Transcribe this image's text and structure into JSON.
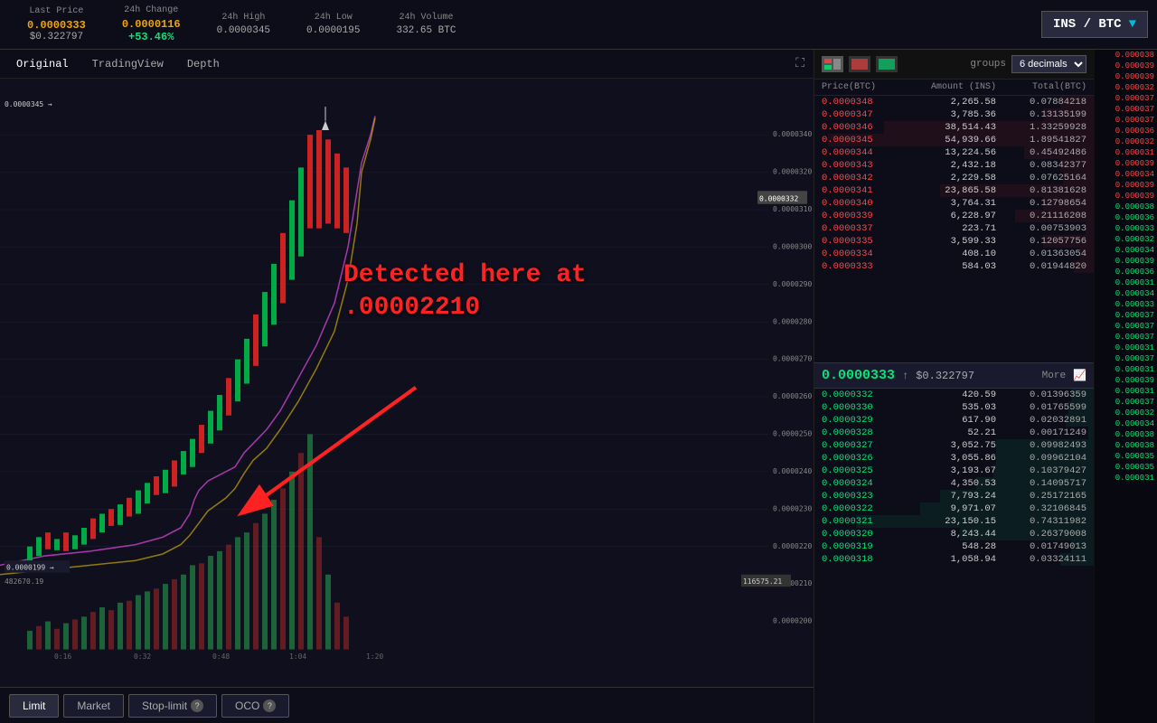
{
  "header": {
    "last_price_label": "Last Price",
    "last_price_btc": "0.0000333",
    "last_price_usd": "$0.322797",
    "change_label": "24h Change",
    "change_btc": "0.0000116",
    "change_pct": "+53.46%",
    "high_label": "24h High",
    "high_val": "0.0000345",
    "low_label": "24h Low",
    "low_val": "0.0000195",
    "volume_label": "24h Volume",
    "volume_val": "332.65 BTC",
    "pair": "INS / BTC"
  },
  "chart_tabs": {
    "original": "Original",
    "tradingview": "TradingView",
    "depth": "Depth",
    "active": "Original"
  },
  "price_labels": {
    "high_arrow": "0.0000345 →",
    "current_price": "0.0000332",
    "low_left": "0.0000199 →",
    "y_labels": [
      "0.0000340",
      "0.0000320",
      "0.0000310",
      "0.0000300",
      "0.0000290",
      "0.0000280",
      "0.0000270",
      "0.0000260",
      "0.0000250",
      "0.0000240",
      "0.0000230",
      "0.0000220",
      "0.0000210",
      "0.0000200"
    ],
    "vol_label": "482670.19",
    "vol_label2": "116575.21"
  },
  "x_labels": [
    "0:16",
    "0:32",
    "0:48",
    "1:04",
    "1:20"
  ],
  "annotation": {
    "line1": "Detected here at",
    "line2": ".00002210"
  },
  "order_book": {
    "groups_label": "groups",
    "decimals": "6 decimals",
    "col_price": "Price(BTC)",
    "col_amount": "Amount (INS)",
    "col_total": "Total(BTC)",
    "sell_orders": [
      {
        "price": "0.0000348",
        "amount": "2,265.58",
        "total": "0.07884218",
        "bar_pct": 12
      },
      {
        "price": "0.0000347",
        "amount": "3,785.36",
        "total": "0.13135199",
        "bar_pct": 18
      },
      {
        "price": "0.0000346",
        "amount": "38,514.43",
        "total": "1.33259928",
        "bar_pct": 75
      },
      {
        "price": "0.0000345",
        "amount": "54,939.66",
        "total": "1.89541827",
        "bar_pct": 95
      },
      {
        "price": "0.0000344",
        "amount": "13,224.56",
        "total": "0.45492486",
        "bar_pct": 25
      },
      {
        "price": "0.0000343",
        "amount": "2,432.18",
        "total": "0.08342377",
        "bar_pct": 12
      },
      {
        "price": "0.0000342",
        "amount": "2,229.58",
        "total": "0.07625164",
        "bar_pct": 11
      },
      {
        "price": "0.0000341",
        "amount": "23,865.58",
        "total": "0.81381628",
        "bar_pct": 55
      },
      {
        "price": "0.0000340",
        "amount": "3,764.31",
        "total": "0.12798654",
        "bar_pct": 18
      },
      {
        "price": "0.0000339",
        "amount": "6,228.97",
        "total": "0.21116208",
        "bar_pct": 28
      },
      {
        "price": "0.0000337",
        "amount": "223.71",
        "total": "0.00753903",
        "bar_pct": 3
      },
      {
        "price": "0.0000335",
        "amount": "3,599.33",
        "total": "0.12057756",
        "bar_pct": 18
      },
      {
        "price": "0.0000334",
        "amount": "408.10",
        "total": "0.01363054",
        "bar_pct": 5
      },
      {
        "price": "0.0000333",
        "amount": "584.03",
        "total": "0.01944820",
        "bar_pct": 7
      }
    ],
    "current_price": "0.0000333",
    "current_arrow": "↑",
    "current_usd": "$0.322797",
    "more_label": "More",
    "buy_orders": [
      {
        "price": "0.0000332",
        "amount": "420.59",
        "total": "0.01396359",
        "bar_pct": 8
      },
      {
        "price": "0.0000330",
        "amount": "535.03",
        "total": "0.01765599",
        "bar_pct": 9
      },
      {
        "price": "0.0000329",
        "amount": "617.90",
        "total": "0.02032891",
        "bar_pct": 10
      },
      {
        "price": "0.0000328",
        "amount": "52.21",
        "total": "0.00171249",
        "bar_pct": 2
      },
      {
        "price": "0.0000327",
        "amount": "3,052.75",
        "total": "0.09982493",
        "bar_pct": 35
      },
      {
        "price": "0.0000326",
        "amount": "3,055.86",
        "total": "0.09962104",
        "bar_pct": 35
      },
      {
        "price": "0.0000325",
        "amount": "3,193.67",
        "total": "0.10379427",
        "bar_pct": 36
      },
      {
        "price": "0.0000324",
        "amount": "4,350.53",
        "total": "0.14095717",
        "bar_pct": 42
      },
      {
        "price": "0.0000323",
        "amount": "7,793.24",
        "total": "0.25172165",
        "bar_pct": 55
      },
      {
        "price": "0.0000322",
        "amount": "9,971.07",
        "total": "0.32106845",
        "bar_pct": 62
      },
      {
        "price": "0.0000321",
        "amount": "23,150.15",
        "total": "0.74311982",
        "bar_pct": 85
      },
      {
        "price": "0.0000320",
        "amount": "8,243.44",
        "total": "0.26379008",
        "bar_pct": 48
      },
      {
        "price": "0.0000319",
        "amount": "548.28",
        "total": "0.01749013",
        "bar_pct": 8
      },
      {
        "price": "0.0000318",
        "amount": "1,058.94",
        "total": "0.03324111",
        "bar_pct": 12
      }
    ]
  },
  "right_col_prices": [
    "0.00003",
    "0.00003",
    "0.00003",
    "0.00003",
    "0.00003",
    "0.00003",
    "0.00003",
    "0.00003",
    "0.00003",
    "0.00003",
    "0.00003",
    "0.00003",
    "0.00003",
    "0.00003",
    "0.00003",
    "0.00003",
    "0.00003",
    "0.00003",
    "0.00003",
    "0.00003",
    "0.00003",
    "0.00003",
    "0.00003",
    "0.00003",
    "0.00003",
    "0.00003",
    "0.00003",
    "0.00003",
    "0.00003",
    "0.00003",
    "0.00003",
    "0.00003",
    "0.00003",
    "0.00003",
    "0.00003",
    "0.00003",
    "0.00003",
    "0.00003",
    "0.00003",
    "0.00003"
  ],
  "bottom_tabs": {
    "limit": "Limit",
    "market": "Market",
    "stop_limit": "Stop-limit",
    "oco": "OCO"
  }
}
